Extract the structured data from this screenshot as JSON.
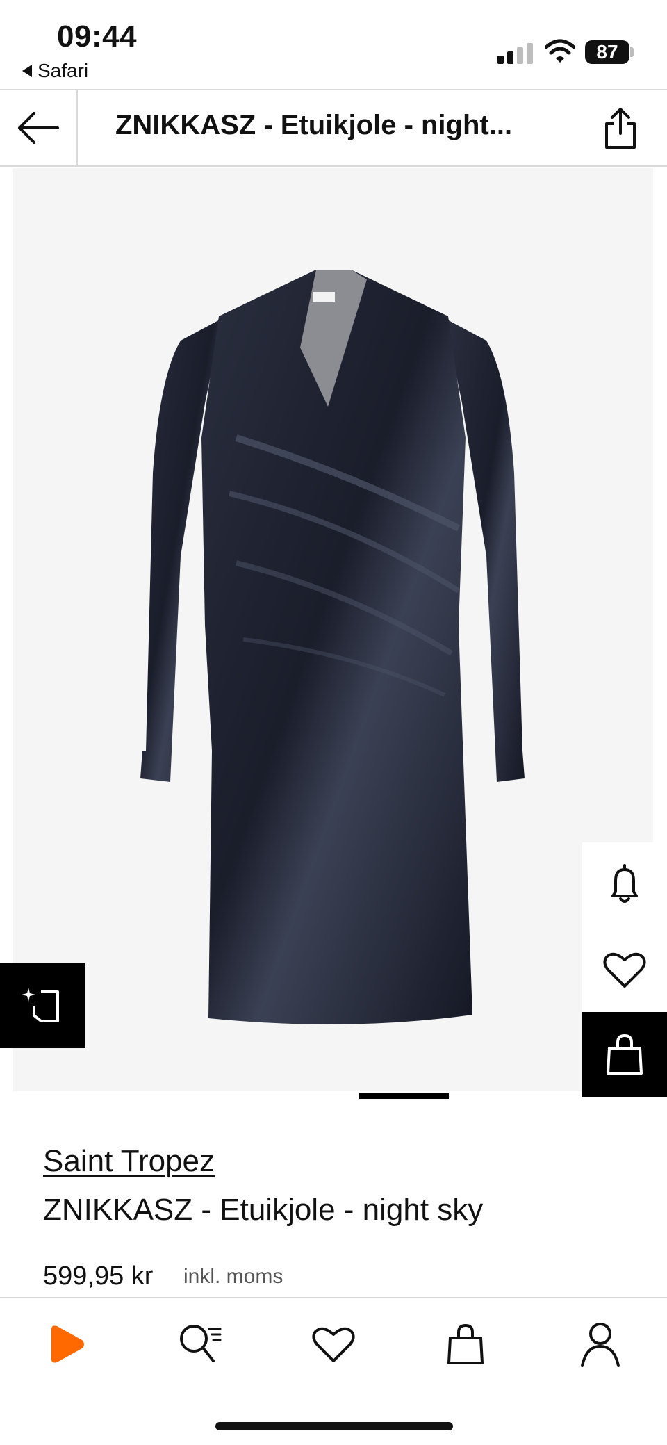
{
  "status_bar": {
    "time": "09:44",
    "back_app": "Safari",
    "battery": "87"
  },
  "header": {
    "title": "ZNIKKASZ  - Etuikjole - night...",
    "back_icon": "arrow-left-icon",
    "share_icon": "share-icon"
  },
  "gallery": {
    "image_alt": "velvet wrap dress",
    "tryon_icon": "virtual-try-on-icon",
    "side_actions": [
      "bell-icon",
      "heart-icon",
      "bag-icon"
    ]
  },
  "product": {
    "brand": "Saint Tropez",
    "name": "ZNIKKASZ  - Etuikjole - night sky",
    "price": "599,95 kr",
    "price_note": "inkl. moms"
  },
  "bottom_nav": {
    "items": [
      "home-icon",
      "search-icon",
      "wishlist-icon",
      "bag-icon",
      "account-icon"
    ],
    "accent": "#ff6900"
  }
}
